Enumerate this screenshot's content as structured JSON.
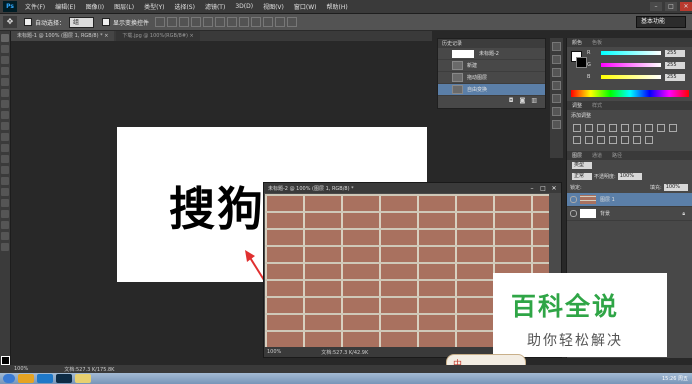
{
  "app": {
    "logo": "Ps"
  },
  "menu": [
    "文件(F)",
    "编辑(E)",
    "图像(I)",
    "图层(L)",
    "类型(Y)",
    "选择(S)",
    "滤镜(T)",
    "3D(D)",
    "视图(V)",
    "窗口(W)",
    "帮助(H)"
  ],
  "window_controls": {
    "min": "–",
    "max": "□",
    "close": "✕"
  },
  "options": {
    "auto_select_label": "自动选择：",
    "auto_select_value": "组",
    "show_transform_label": "显示变换控件",
    "workspace": "基本功能"
  },
  "doc_tabs": [
    {
      "label": "未标题-1 @ 100% (图层 1, RGB/8) * ×"
    },
    {
      "label": "下载.jpg @ 100%(RGB/8#) ×"
    }
  ],
  "canvas": {
    "text": "搜狗指南"
  },
  "brick_window": {
    "title": "未标题-2 @ 100% (图层 1, RGB/8) *",
    "zoom": "100%",
    "doc_info": "文档:527.3 K/42.9K"
  },
  "history": {
    "title": "历史记录",
    "snapshot": "未标题-2",
    "items": [
      "新建",
      "拖动图层",
      "自由变换"
    ]
  },
  "color_panel": {
    "tabs": [
      "颜色",
      "色板"
    ],
    "rows": [
      {
        "label": "R",
        "value": "255"
      },
      {
        "label": "G",
        "value": "255"
      },
      {
        "label": "B",
        "value": "255"
      }
    ]
  },
  "adjust_panel": {
    "tabs": [
      "调整",
      "样式"
    ],
    "title": "添加调整"
  },
  "layers_panel": {
    "tabs": [
      "图层",
      "通道",
      "路径"
    ],
    "kind": "类型",
    "blend": "正常",
    "opacity_label": "不透明度:",
    "opacity": "100%",
    "lock_label": "锁定:",
    "fill_label": "填充:",
    "fill": "100%",
    "layers": [
      {
        "name": "图层 1",
        "selected": true
      },
      {
        "name": "背景",
        "selected": false
      }
    ]
  },
  "statusbar": {
    "zoom": "100%",
    "doc_info": "文档:527.3 K/175.8K"
  },
  "watermark": {
    "title": "百科全说",
    "subtitle": "助你轻松解决"
  },
  "ime": {
    "label": "中"
  },
  "taskbar": {
    "clock": "15:26 周五"
  },
  "colors": {
    "selection": "#5b7fa8",
    "watermark_green": "#2fa546",
    "arrow": "#e03030"
  }
}
